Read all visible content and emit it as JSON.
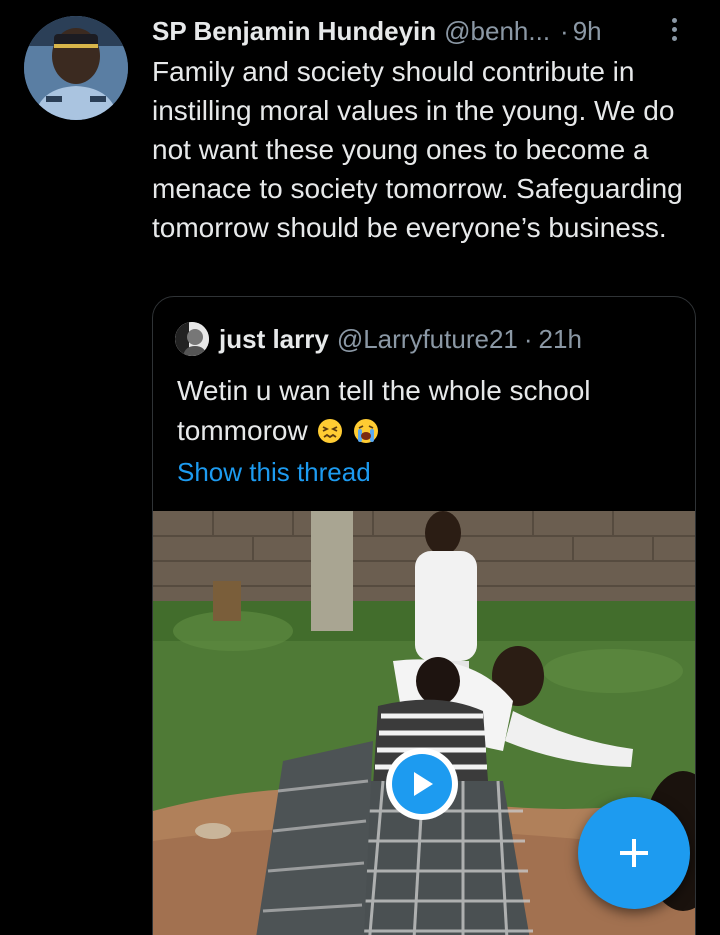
{
  "tweet": {
    "author_name": "SP Benjamin Hundeyin",
    "author_handle": "@benh...",
    "separator": "·",
    "time": "9h",
    "text": "Family and society should contribute in instilling moral values in the young. We do not want these young ones to become a menace to society tomorrow. Safeguarding tomorrow should be everyone’s business.",
    "more_icon": "vertical-ellipsis-icon"
  },
  "quoted_tweet": {
    "author_name": "just larry",
    "author_handle": "@Larryfuture21",
    "separator": "·",
    "time": "21h",
    "text": "Wetin u wan tell the whole school tommorow",
    "emojis": [
      "confounded-face-emoji",
      "crying-face-emoji"
    ],
    "show_thread_label": "Show this thread",
    "media_type": "video",
    "play_icon": "play-icon"
  },
  "fab": {
    "icon": "plus-icon"
  },
  "colors": {
    "background": "#000000",
    "text": "#e7e9ea",
    "muted": "#8b98a5",
    "accent": "#1d9bf0",
    "border": "#2f3336"
  }
}
